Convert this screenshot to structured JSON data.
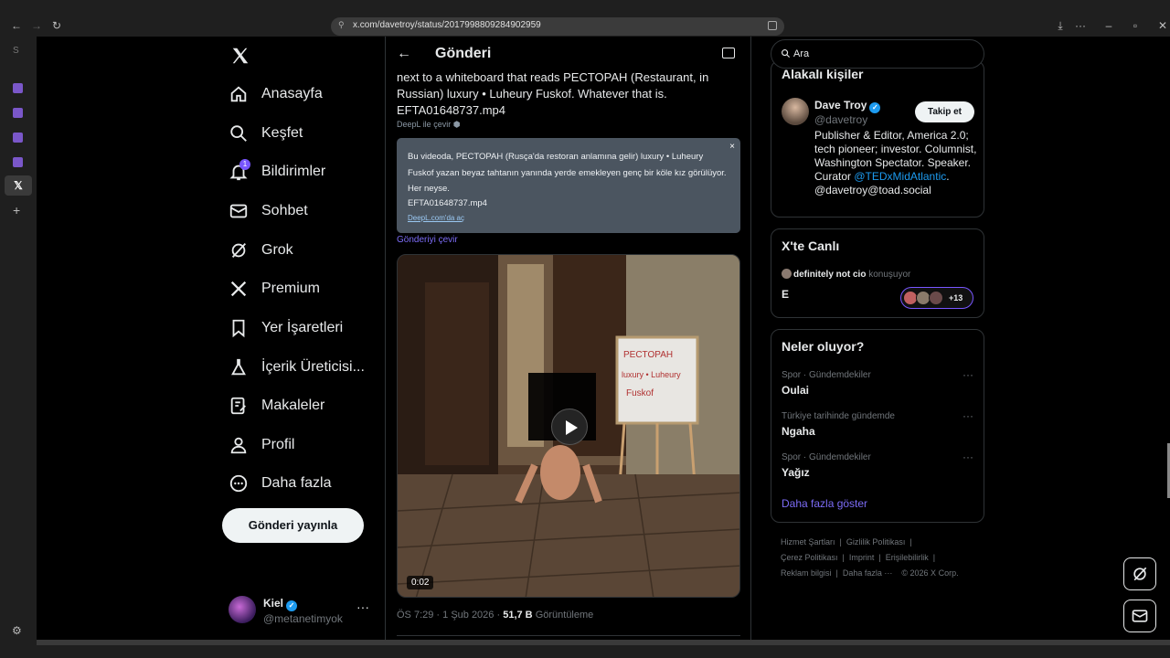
{
  "browser": {
    "url": "x.com/davetroy/status/2017998809284902959",
    "strip_label": "S"
  },
  "nav": {
    "items": [
      {
        "label": "Anasayfa",
        "icon": "home-icon"
      },
      {
        "label": "Keşfet",
        "icon": "search-icon"
      },
      {
        "label": "Bildirimler",
        "icon": "bell-icon",
        "badge": "1"
      },
      {
        "label": "Sohbet",
        "icon": "mail-icon"
      },
      {
        "label": "Grok",
        "icon": "grok-icon"
      },
      {
        "label": "Premium",
        "icon": "x-logo-icon"
      },
      {
        "label": "Yer İşaretleri",
        "icon": "bookmark-icon"
      },
      {
        "label": "İçerik Üreticisi...",
        "icon": "flask-icon"
      },
      {
        "label": "Makaleler",
        "icon": "article-icon"
      },
      {
        "label": "Profil",
        "icon": "person-icon"
      },
      {
        "label": "Daha fazla",
        "icon": "more-circle-icon"
      }
    ],
    "post_button": "Gönderi yayınla",
    "account": {
      "name": "Kiel",
      "handle": "@metanetimyok",
      "more": "···"
    }
  },
  "main": {
    "header_title": "Gönderi",
    "tweet_text": "next to a whiteboard that reads PECTOPAH (Restaurant, in Russian) luxury • Luheury Fuskof. Whatever that is.",
    "tweet_file": "EFTA01648737.mp4",
    "deepl_link": "DeepL ile çevir",
    "translation": {
      "text": "Bu videoda, PECTOPAH (Rusça'da restoran anlamına gelir) luxury • Luheury Fuskof yazan beyaz tahtanın yanında yerde emekleyen genç bir köle kız görülüyor. Her neyse.",
      "file": "EFTA01648737.mp4",
      "open_link": "DeepL.com'da aç",
      "close": "×"
    },
    "translate_post": "Gönderiyi çevir",
    "video": {
      "time": "0:02",
      "whiteboard": [
        "PECTOPAH",
        "luxury • Luheury",
        "Fuskof"
      ]
    },
    "meta": {
      "time": "ÖS 7:29",
      "date": "1 Şub 2026",
      "views": "51,7 B",
      "views_label": "Görüntüleme"
    }
  },
  "right": {
    "search_placeholder": "Ara",
    "relevant": {
      "title": "Alakalı kişiler",
      "name": "Dave Troy",
      "handle": "@davetroy",
      "follow": "Takip et",
      "bio_pre": "Publisher & Editor, America 2.0; tech pioneer; investor. Columnist, Washington Spectator. Speaker. Curator ",
      "bio_link": "@TEDxMidAtlantic",
      "bio_post": ". @davetroy@toad.social"
    },
    "live": {
      "title": "X'te Canlı",
      "speaker": "definitely not cio",
      "speaking": "konuşuyor",
      "space_title": "E",
      "count": "+13"
    },
    "trends": {
      "title": "Neler oluyor?",
      "items": [
        {
          "category": "Spor · Gündemdekiler",
          "name": "Oulai"
        },
        {
          "category": "Türkiye tarihinde gündemde",
          "name": "Ngaha"
        },
        {
          "category": "Spor · Gündemdekiler",
          "name": "Yağız"
        }
      ],
      "show_more": "Daha fazla göster"
    },
    "footer": {
      "terms": "Hizmet Şartları",
      "privacy": "Gizlilik Politikası",
      "cookies": "Çerez Politikası",
      "imprint": "Imprint",
      "accessibility": "Erişilebilirlik",
      "ads": "Reklam bilgisi",
      "more": "Daha fazla ···",
      "copyright": "© 2026 X Corp."
    }
  }
}
